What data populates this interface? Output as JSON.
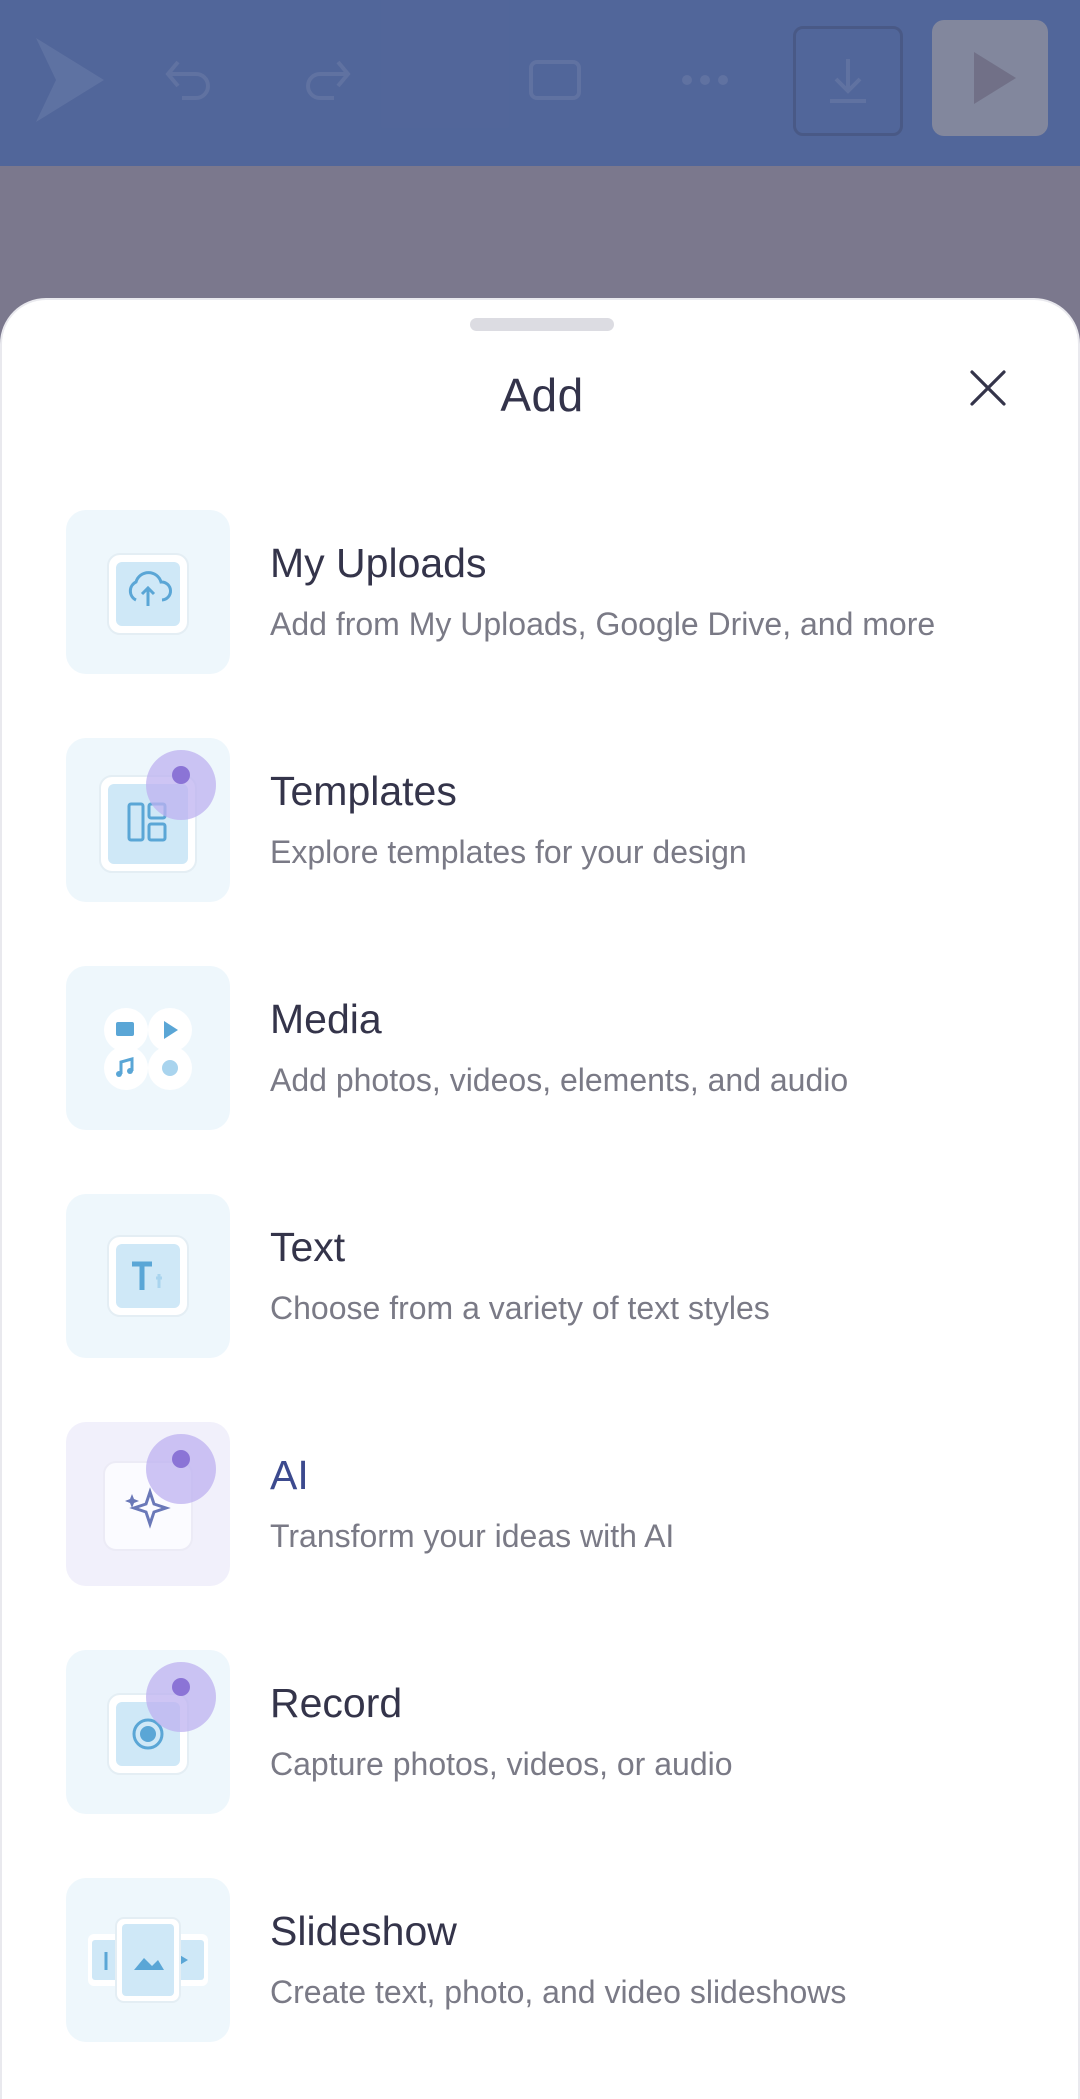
{
  "sheet": {
    "title": "Add",
    "close_icon": "close-icon"
  },
  "items": [
    {
      "key": "uploads",
      "icon": "cloud-upload-icon",
      "title": "My Uploads",
      "description": "Add from My Uploads, Google Drive, and more",
      "badge": false
    },
    {
      "key": "templates",
      "icon": "template-layout-icon",
      "title": "Templates",
      "description": "Explore templates for your design",
      "badge": true
    },
    {
      "key": "media",
      "icon": "media-icon",
      "title": "Media",
      "description": "Add photos, videos, elements, and audio",
      "badge": false
    },
    {
      "key": "text",
      "icon": "text-icon",
      "title": "Text",
      "description": "Choose from a variety of text styles",
      "badge": false
    },
    {
      "key": "ai",
      "icon": "ai-sparkle-icon",
      "title": "AI",
      "description": "Transform your ideas with AI",
      "badge": true
    },
    {
      "key": "record",
      "icon": "record-icon",
      "title": "Record",
      "description": "Capture photos, videos, or audio",
      "badge": true
    },
    {
      "key": "slideshow",
      "icon": "slideshow-icon",
      "title": "Slideshow",
      "description": "Create text, photo, and video slideshows",
      "badge": false
    }
  ],
  "colors": {
    "toolbar": "#3d5ea3",
    "tile_bg": "#eef7fc",
    "icon_blue": "#5aa6d6",
    "badge_purple": "#8b74d6",
    "title_text": "#34344a",
    "ai_title_text": "#3c4a8e",
    "desc_text": "#7a7a86"
  }
}
